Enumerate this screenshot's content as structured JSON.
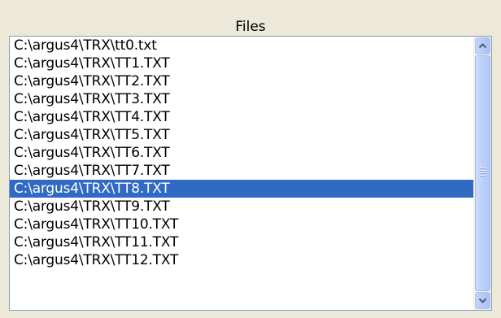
{
  "header": {
    "title": "Files"
  },
  "files": {
    "items": [
      "C:\\argus4\\TRX\\tt0.txt",
      "C:\\argus4\\TRX\\TT1.TXT",
      "C:\\argus4\\TRX\\TT2.TXT",
      "C:\\argus4\\TRX\\TT3.TXT",
      "C:\\argus4\\TRX\\TT4.TXT",
      "C:\\argus4\\TRX\\TT5.TXT",
      "C:\\argus4\\TRX\\TT6.TXT",
      "C:\\argus4\\TRX\\TT7.TXT",
      "C:\\argus4\\TRX\\TT8.TXT",
      "C:\\argus4\\TRX\\TT9.TXT",
      "C:\\argus4\\TRX\\TT10.TXT",
      "C:\\argus4\\TRX\\TT11.TXT",
      "C:\\argus4\\TRX\\TT12.TXT"
    ],
    "selected_index": 8
  },
  "scrollbar": {
    "up_icon": "chevron-up-icon",
    "down_icon": "chevron-down-icon",
    "grip_icon": "grip-icon"
  },
  "colors": {
    "selection": "#316ac5",
    "background": "#ece9d8"
  }
}
